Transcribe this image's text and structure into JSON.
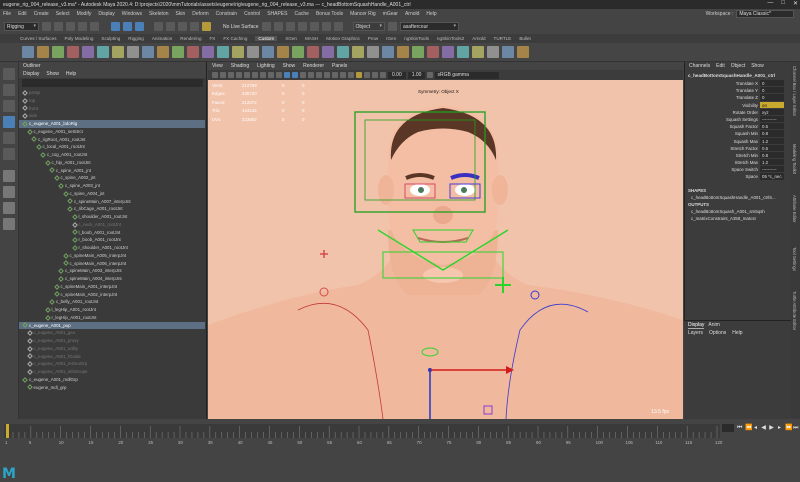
{
  "titlebar": {
    "title": "eugene_rig_004_release_v3.ma* - Autodesk Maya 2020.4: D:\\projects\\2020\\mmTutorials\\assets\\eugene\\rig\\eugene_rig_004_release_v3.ma  ---  c_headBottomSquashHandle_A001_ctrl",
    "minimize": "—",
    "maximize": "□",
    "close": "✕"
  },
  "menubar": {
    "items": [
      "File",
      "Edit",
      "Create",
      "Select",
      "Modify",
      "Display",
      "Windows",
      "Skeleton",
      "Skin",
      "Deform",
      "Constrain",
      "Control",
      "SHAPES",
      "Cache",
      "Bonus Tools",
      "Mancer Rig",
      "mGear",
      "Arnold",
      "Help"
    ],
    "workspace_label": "Workspace :",
    "workspace_value": "Maya Classic*"
  },
  "statusline": {
    "mode": "Rigging",
    "surface_label": "No Live Surface",
    "object_field": "Object",
    "user_field": "asaftercour"
  },
  "shelf_tabs": {
    "items": [
      "Curves / Surfaces",
      "Poly Modeling",
      "Sculpting",
      "Rigging",
      "Animation",
      "Rendering",
      "FX",
      "FX Caching",
      "Custom",
      "XGen",
      "MASH",
      "Motion Graphics",
      "Prow",
      "IGen",
      "ngSkinTools",
      "ngSkinTools2",
      "Arnold",
      "TURTLE",
      "Bullet"
    ],
    "active": "Custom"
  },
  "outliner": {
    "title": "Outliner",
    "menu": [
      "Display",
      "Show",
      "Help"
    ],
    "rows": [
      {
        "label": "persp",
        "indent": 0,
        "dim": true
      },
      {
        "label": "top",
        "indent": 0,
        "dim": true
      },
      {
        "label": "front",
        "indent": 0,
        "dim": true
      },
      {
        "label": "side",
        "indent": 0,
        "dim": true
      },
      {
        "label": "c_eugene_A001_bdoRig",
        "indent": 0,
        "hl": true
      },
      {
        "label": "c_eugene_A001_setStrct",
        "indent": 1
      },
      {
        "label": "c_rigRoot_A001_rootJnt",
        "indent": 2
      },
      {
        "label": "c_local_A001_rootJnt",
        "indent": 3
      },
      {
        "label": "c_cog_A001_rootJnt",
        "indent": 4
      },
      {
        "label": "c_hip_A001_rootJnt",
        "indent": 5
      },
      {
        "label": "c_spine_A001_jnt",
        "indent": 6
      },
      {
        "label": "c_spine_A002_jnt",
        "indent": 7
      },
      {
        "label": "c_spine_A003_jnt",
        "indent": 8
      },
      {
        "label": "c_spine_A004_jnt",
        "indent": 9
      },
      {
        "label": "c_spineMain_A007_interpJnt",
        "indent": 10
      },
      {
        "label": "c_ribCage_A001_rootJnt",
        "indent": 10
      },
      {
        "label": "l_shoulder_A001_rootJnt",
        "indent": 11
      },
      {
        "label": "c_neck_A001_rootJnt",
        "indent": 11,
        "dim": true
      },
      {
        "label": "l_boob_A001_rootJnt",
        "indent": 11
      },
      {
        "label": "r_boob_A001_rootJnt",
        "indent": 11
      },
      {
        "label": "r_shoulder_A001_rootJnt",
        "indent": 11
      },
      {
        "label": "c_spineMain_A005_interpJnt",
        "indent": 9
      },
      {
        "label": "c_spineMain_A006_interpJnt",
        "indent": 9
      },
      {
        "label": "c_spineMain_A003_interpJnt",
        "indent": 8
      },
      {
        "label": "c_spineMain_A004_interpJnt",
        "indent": 8
      },
      {
        "label": "c_spineMain_A001_interpJnt",
        "indent": 7
      },
      {
        "label": "c_spineMain_A002_interpJnt",
        "indent": 7
      },
      {
        "label": "c_belly_A001_rootJnt",
        "indent": 6
      },
      {
        "label": "l_legHip_A001_rootJnt",
        "indent": 5
      },
      {
        "label": "r_legHip_A001_rootJnt",
        "indent": 5
      },
      {
        "label": "c_eugene_A001_pup",
        "indent": 0,
        "hl": true
      },
      {
        "label": "c_eugene_A001_geo",
        "indent": 1,
        "dim": true
      },
      {
        "label": "c_eugene_A001_proxy",
        "indent": 1,
        "dim": true
      },
      {
        "label": "c_eugene_A001_utility",
        "indent": 1,
        "dim": true
      },
      {
        "label": "c_eugene_A001_fGuide",
        "indent": 1,
        "dim": true
      },
      {
        "label": "c_eugene_A001_mGeoGrp",
        "indent": 1,
        "dim": true
      },
      {
        "label": "c_eugene_A001_infoScope",
        "indent": 1,
        "dim": true
      },
      {
        "label": "c_eugene_A001_mdlGrp",
        "indent": 0
      },
      {
        "label": "eugene_mdl_grp",
        "indent": 1
      }
    ]
  },
  "viewport": {
    "menu": [
      "View",
      "Shading",
      "Lighting",
      "Show",
      "Renderer",
      "Panels"
    ],
    "near": "0.00",
    "far": "1.00",
    "colorspace": "sRGB gamma",
    "hud": [
      {
        "k": "Verts:",
        "a": "212769",
        "b": "0",
        "c": "0"
      },
      {
        "k": "Edges:",
        "a": "425720",
        "b": "0",
        "c": "0"
      },
      {
        "k": "Faces:",
        "a": "212072",
        "b": "0",
        "c": "0"
      },
      {
        "k": "Tris:",
        "a": "424144",
        "b": "0",
        "c": "0"
      },
      {
        "k": "UVs:",
        "a": "223652",
        "b": "0",
        "c": "0"
      }
    ],
    "symmetry": "Symmetry: Object X",
    "fps": "13.5 fps"
  },
  "channelbox": {
    "menu": [
      "Channels",
      "Edit",
      "Object",
      "Show"
    ],
    "node": "c_headBottomSquashHandle_A001_ctrl",
    "channels": [
      {
        "label": "Translate X",
        "value": "0"
      },
      {
        "label": "Translate Y",
        "value": "0"
      },
      {
        "label": "Translate Z",
        "value": "0"
      },
      {
        "label": "Visibility",
        "value": "on",
        "hl": true
      },
      {
        "label": "Rotate Order",
        "value": "xyz"
      },
      {
        "label": "Squash Settings",
        "value": "----------"
      },
      {
        "label": "Squash Factor",
        "value": "0.5"
      },
      {
        "label": "Squash Min",
        "value": "0.8"
      },
      {
        "label": "Squash Max",
        "value": "1.2"
      },
      {
        "label": "Stretch Factor",
        "value": "0.5"
      },
      {
        "label": "Stretch Min",
        "value": "0.8"
      },
      {
        "label": "Stretch Max",
        "value": "1.2"
      },
      {
        "label": "Space Switch",
        "value": "----------"
      },
      {
        "label": "Space",
        "value": "05 *c_nec"
      }
    ],
    "shapes_title": "SHAPES",
    "shape_node": "c_headBottomSquashHandle_A001_ctrlS...",
    "outputs_title": "OUTPUTS",
    "outputs": [
      "c_headBottomSquash_A001_sm5qsh",
      "c_matrixConstraint_A358_matcst"
    ]
  },
  "layers": {
    "tabs": [
      "Display",
      "Anim"
    ],
    "menu": [
      "Layers",
      "Options",
      "Help"
    ]
  },
  "sidetabs": [
    "Channel Box / Layer Editor",
    "Modeling Toolkit",
    "Attribute Editor",
    "Tool Settings",
    "Turtle Attribute Editor"
  ],
  "timeline": {
    "ticks": [
      "1",
      "5",
      "10",
      "15",
      "20",
      "25",
      "30",
      "35",
      "40",
      "45",
      "50",
      "55",
      "60",
      "65",
      "70",
      "75",
      "80",
      "85",
      "90",
      "95",
      "100",
      "105",
      "110",
      "115",
      "120"
    ]
  },
  "logo": "M",
  "colors": {
    "viewport_bg": "#f2c3ab",
    "accent": "#4a7fb8",
    "highlight": "#c9a92e"
  }
}
